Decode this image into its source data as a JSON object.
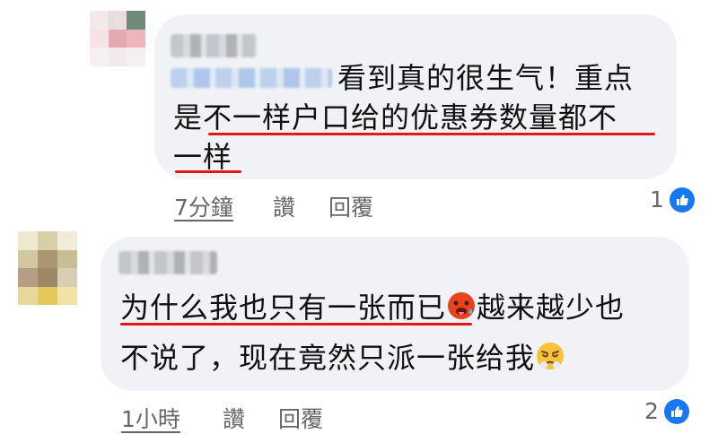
{
  "comments": [
    {
      "line1": "看到真的很生气！重点",
      "line2": "是不一样户口给的优惠券数量都不",
      "line3": "一样",
      "time": "7分鐘",
      "like": "讚",
      "reply": "回覆",
      "reaction_count": "1"
    },
    {
      "line1": "为什么我也只有一张而已",
      "line1b": "越来越少也",
      "line2": "不说了，现在竟然只派一张给我",
      "time": "1小時",
      "like": "讚",
      "reply": "回覆",
      "reaction_count": "2"
    }
  ],
  "icons": {
    "reaction": "like-thumb-icon",
    "emoji_1": "hot-face-emoji-icon",
    "emoji_2": "steam-from-nose-emoji-icon"
  },
  "colors": {
    "bubble": "#f0f2f5",
    "meta": "#65676b",
    "highlight": "#e01818",
    "like": "#1877f2"
  }
}
